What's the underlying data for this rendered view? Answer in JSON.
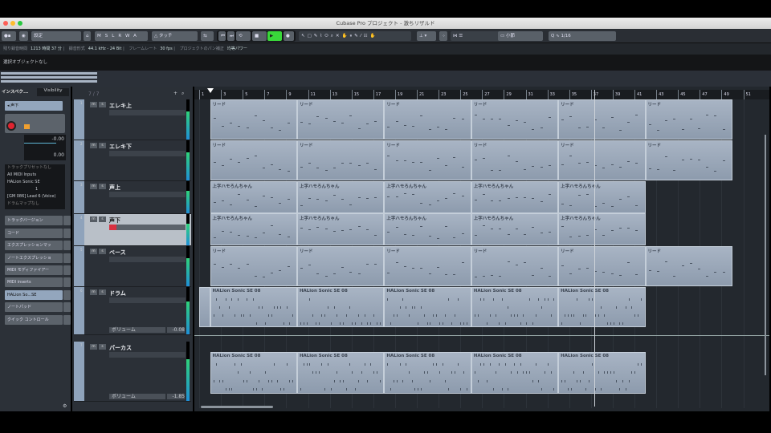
{
  "window": {
    "title": "Cubase Pro プロジェクト - 激ちリザルド"
  },
  "toolbar": {
    "preset": "設定",
    "msl": [
      "M",
      "S",
      "L",
      "R",
      "W",
      "A"
    ],
    "automation_mode": "タッチ",
    "snap_type": "小節",
    "quantize": "1/16",
    "transport": {
      "playing": true,
      "accent": "#39d83a"
    }
  },
  "info": {
    "record_time_label": "残り録音時間",
    "record_time": "1213 時間 37 分",
    "format_label": "録音形式",
    "format": "44.1 kHz - 24 Bit",
    "framerate_label": "フレームレート",
    "framerate": "30 fps",
    "pan_label": "プロジェクトのパン補正",
    "pan": "均等パワー"
  },
  "selection": {
    "text": "選択オブジェクトなし"
  },
  "inspector": {
    "tabs": [
      "インスペク...",
      "Visibility"
    ],
    "track_name": "声下",
    "volume": "-0.00",
    "pan": "0.00",
    "preset": "トラックプリセットなし",
    "input": "All MIDI Inputs",
    "output": "HALion Sonic SE",
    "channel": "1",
    "program": "[GM 086] Lead 6 (Voice)",
    "drummap": "ドラムマップなし",
    "sections": [
      "トラックバージョン",
      "コード",
      "エクスプレッションマッ",
      "ノートエクスプレッショ",
      "MIDI モディファイアー",
      "MIDI inserts",
      "HALion So...SE",
      "ノートパッド",
      "クイック コントロール"
    ]
  },
  "tracklist": {
    "count": "7 / 7",
    "tracks": [
      {
        "num": "1",
        "name": "エレキ上"
      },
      {
        "num": "2",
        "name": "エレキ下"
      },
      {
        "num": "3",
        "name": "声上"
      },
      {
        "num": "4",
        "name": "声下",
        "selected": true
      },
      {
        "num": "5",
        "name": "ベース"
      },
      {
        "num": "6",
        "name": "ドラム",
        "volume_label": "ボリューム",
        "volume": "-0.08"
      },
      {
        "num": "7",
        "name": "パーカス",
        "volume_label": "ボリューム",
        "volume": "-1.85"
      }
    ]
  },
  "ruler": {
    "bars": [
      "1",
      "3",
      "5",
      "7",
      "9",
      "11",
      "13",
      "15",
      "17",
      "19",
      "21",
      "23",
      "25",
      "27",
      "29",
      "31",
      "33",
      "35",
      "37",
      "39",
      "41",
      "43",
      "45",
      "47",
      "49",
      "51"
    ]
  },
  "lanes": [
    {
      "parts": [
        {
          "name": "リード",
          "start": 2,
          "end": 10
        },
        {
          "name": "リード",
          "start": 10,
          "end": 18
        },
        {
          "name": "リード",
          "start": 18,
          "end": 26
        },
        {
          "name": "リード",
          "start": 26,
          "end": 34
        },
        {
          "name": "リード",
          "start": 34,
          "end": 42
        },
        {
          "name": "リード",
          "start": 42,
          "end": 50
        }
      ]
    },
    {
      "parts": [
        {
          "name": "リード",
          "start": 2,
          "end": 10
        },
        {
          "name": "リード",
          "start": 10,
          "end": 18
        },
        {
          "name": "リード",
          "start": 18,
          "end": 26
        },
        {
          "name": "リード",
          "start": 26,
          "end": 34
        },
        {
          "name": "リード",
          "start": 34,
          "end": 42
        },
        {
          "name": "リード",
          "start": 42,
          "end": 50
        }
      ]
    },
    {
      "parts": [
        {
          "name": "上字ハモろんちゃん",
          "start": 2,
          "end": 10
        },
        {
          "name": "上字ハモろんちゃん",
          "start": 10,
          "end": 18
        },
        {
          "name": "上字ハモろんちゃん",
          "start": 18,
          "end": 26
        },
        {
          "name": "上字ハモろんちゃん",
          "start": 26,
          "end": 34
        },
        {
          "name": "上字ハモろんちゃん",
          "start": 34,
          "end": 42
        }
      ]
    },
    {
      "parts": [
        {
          "name": "上字ハモろんちゃん",
          "start": 2,
          "end": 10
        },
        {
          "name": "上字ハモろんちゃん",
          "start": 10,
          "end": 18
        },
        {
          "name": "上字ハモろんちゃん",
          "start": 18,
          "end": 26
        },
        {
          "name": "上字ハモろんちゃん",
          "start": 26,
          "end": 34
        },
        {
          "name": "上字ハモろんちゃん",
          "start": 34,
          "end": 42
        }
      ]
    },
    {
      "parts": [
        {
          "name": "リード",
          "start": 2,
          "end": 10
        },
        {
          "name": "リード",
          "start": 10,
          "end": 18
        },
        {
          "name": "リード",
          "start": 18,
          "end": 26
        },
        {
          "name": "リード",
          "start": 26,
          "end": 34
        },
        {
          "name": "リード",
          "start": 34,
          "end": 42
        },
        {
          "name": "リード",
          "start": 42,
          "end": 50
        }
      ]
    },
    {
      "parts": [
        {
          "name": "",
          "start": 1,
          "end": 2
        },
        {
          "name": "HALion Sonic SE 08",
          "start": 2,
          "end": 10
        },
        {
          "name": "HALion Sonic SE 08",
          "start": 10,
          "end": 18
        },
        {
          "name": "HALion Sonic SE 08",
          "start": 18,
          "end": 26
        },
        {
          "name": "HALion Sonic SE 08",
          "start": 26,
          "end": 34
        },
        {
          "name": "HALion Sonic SE 08",
          "start": 34,
          "end": 42
        }
      ]
    },
    {
      "parts": [
        {
          "name": "HALion Sonic SE 08",
          "start": 2,
          "end": 10
        },
        {
          "name": "HALion Sonic SE 08",
          "start": 10,
          "end": 18
        },
        {
          "name": "HALion Sonic SE 08",
          "start": 18,
          "end": 26
        },
        {
          "name": "HALion Sonic SE 08",
          "start": 26,
          "end": 34
        },
        {
          "name": "HALion Sonic SE 08",
          "start": 34,
          "end": 42
        }
      ]
    }
  ],
  "playhead_bar": 37.3,
  "left_locator_bar": 2
}
